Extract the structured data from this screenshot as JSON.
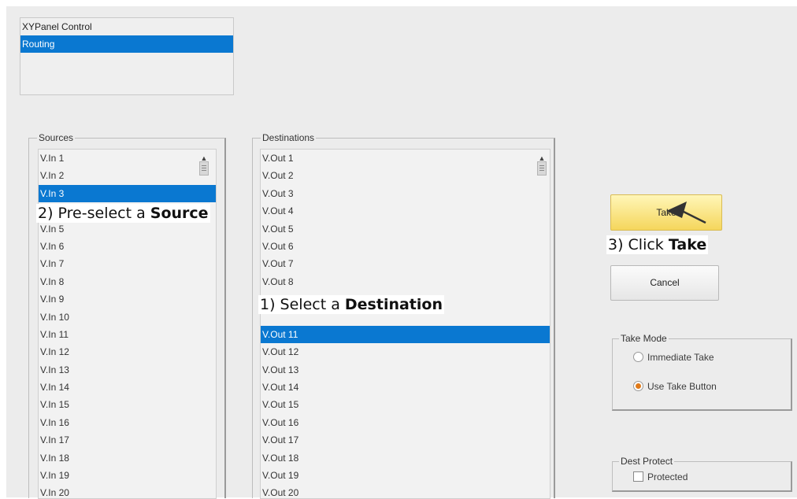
{
  "panel_list": [
    {
      "label": "XYPanel Control",
      "selected": false
    },
    {
      "label": "Routing",
      "selected": true
    }
  ],
  "sources": {
    "legend": "Sources",
    "items": [
      "V.In 1",
      "V.In 2",
      "V.In 3",
      "",
      "V.In 5",
      "V.In 6",
      "V.In 7",
      "V.In 8",
      "V.In 9",
      "V.In 10",
      "V.In 11",
      "V.In 12",
      "V.In 13",
      "V.In 14",
      "V.In 15",
      "V.In 16",
      "V.In 17",
      "V.In 18",
      "V.In 19",
      "V.In 20"
    ],
    "selected_index": 2
  },
  "destinations": {
    "legend": "Destinations",
    "items": [
      "V.Out 1",
      "V.Out 2",
      "V.Out 3",
      "V.Out 4",
      "V.Out 5",
      "V.Out 6",
      "V.Out 7",
      "V.Out 8",
      "",
      "",
      "V.Out 11",
      "V.Out 12",
      "V.Out 13",
      "V.Out 14",
      "V.Out 15",
      "V.Out 16",
      "V.Out 17",
      "V.Out 18",
      "V.Out 19",
      "V.Out 20"
    ],
    "selected_index": 10
  },
  "annotations": {
    "step1_prefix": "1) Select a ",
    "step1_bold": "Destination",
    "step2_prefix": "2) Pre-select a ",
    "step2_bold": "Source",
    "step3_prefix": "3) Click ",
    "step3_bold": "Take"
  },
  "buttons": {
    "take_label": "Take",
    "cancel_label": "Cancel"
  },
  "take_mode": {
    "legend": "Take Mode",
    "options": [
      {
        "label": "Immediate Take",
        "checked": false
      },
      {
        "label": "Use Take Button",
        "checked": true
      }
    ]
  },
  "dest_protect": {
    "legend": "Dest Protect",
    "checkbox_label": "Protected",
    "checked": false
  },
  "colors": {
    "selection": "#0a78d1",
    "take_button": "#f5d65c",
    "radio_on": "#e07a1a"
  }
}
